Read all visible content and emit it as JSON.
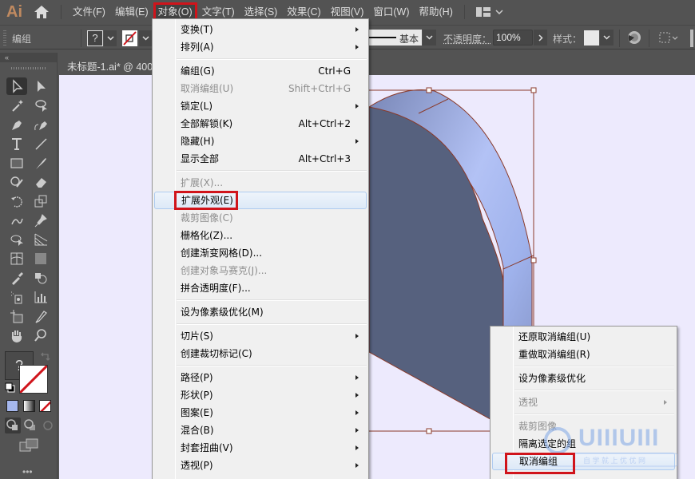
{
  "app": {
    "logo": "Ai"
  },
  "menubar": {
    "items": [
      {
        "label": "文件(F)"
      },
      {
        "label": "编辑(E)"
      },
      {
        "label": "对象(O)",
        "active": true
      },
      {
        "label": "文字(T)"
      },
      {
        "label": "选择(S)"
      },
      {
        "label": "效果(C)"
      },
      {
        "label": "视图(V)"
      },
      {
        "label": "窗口(W)"
      },
      {
        "label": "帮助(H)"
      }
    ]
  },
  "control_bar": {
    "selection_label": "编组",
    "fill_value": "?",
    "stroke_style": "基本",
    "opacity_label": "不透明度：",
    "opacity_value": "100%",
    "style_label": "样式："
  },
  "document": {
    "tab_title": "未标题-1.ai* @ 400"
  },
  "colors": {
    "accent_red": "#d0141b",
    "canvas_bg": "#edeafd",
    "shape_face": "#56617e",
    "shape_side": "#a5b4ee",
    "selection": "#8a3a2a"
  },
  "object_menu": {
    "items": [
      {
        "label": "变换(T)",
        "submenu": true
      },
      {
        "label": "排列(A)",
        "submenu": true
      },
      {
        "sep": true
      },
      {
        "label": "编组(G)",
        "shortcut": "Ctrl+G"
      },
      {
        "label": "取消编组(U)",
        "shortcut": "Shift+Ctrl+G",
        "disabled": true
      },
      {
        "label": "锁定(L)",
        "submenu": true
      },
      {
        "label": "全部解锁(K)",
        "shortcut": "Alt+Ctrl+2"
      },
      {
        "label": "隐藏(H)",
        "submenu": true
      },
      {
        "label": "显示全部",
        "shortcut": "Alt+Ctrl+3"
      },
      {
        "sep": true
      },
      {
        "label": "扩展(X)...",
        "disabled": true
      },
      {
        "label": "扩展外观(E)",
        "highlighted": true
      },
      {
        "label": "裁剪图像(C)",
        "disabled": true
      },
      {
        "label": "栅格化(Z)..."
      },
      {
        "label": "创建渐变网格(D)..."
      },
      {
        "label": "创建对象马赛克(J)...",
        "disabled": true
      },
      {
        "label": "拼合透明度(F)..."
      },
      {
        "sep": true
      },
      {
        "label": "设为像素级优化(M)"
      },
      {
        "sep": true
      },
      {
        "label": "切片(S)",
        "submenu": true
      },
      {
        "label": "创建裁切标记(C)"
      },
      {
        "sep": true
      },
      {
        "label": "路径(P)",
        "submenu": true
      },
      {
        "label": "形状(P)",
        "submenu": true
      },
      {
        "label": "图案(E)",
        "submenu": true
      },
      {
        "label": "混合(B)",
        "submenu": true
      },
      {
        "label": "封套扭曲(V)",
        "submenu": true
      },
      {
        "label": "透视(P)",
        "submenu": true
      }
    ]
  },
  "context_menu": {
    "items": [
      {
        "label": "还原取消编组(U)"
      },
      {
        "label": "重做取消编组(R)"
      },
      {
        "sep": true
      },
      {
        "label": "设为像素级优化"
      },
      {
        "sep": true
      },
      {
        "label": "透视",
        "submenu": true,
        "disabled": true
      },
      {
        "sep": true
      },
      {
        "label": "裁剪图像",
        "disabled": true
      },
      {
        "label": "隔离选定的组"
      },
      {
        "label": "取消编组",
        "highlighted": true
      }
    ]
  },
  "watermark": {
    "brand": "UIIIUIII",
    "tagline": "自 学 就 上 优 优 网"
  },
  "tools": [
    "selection-tool",
    "direct-selection-tool",
    "magic-wand-tool",
    "lasso-tool",
    "pen-tool",
    "curvature-tool",
    "type-tool",
    "line-tool",
    "rectangle-tool",
    "paintbrush-tool",
    "shaper-tool",
    "eraser-tool",
    "rotate-tool",
    "scale-tool",
    "puppet-warp-tool",
    "pin-tool",
    "shape-builder-tool",
    "perspective-grid-tool",
    "mesh-tool",
    "gradient-tool",
    "eyedropper-tool",
    "blend-tool",
    "symbol-sprayer-tool",
    "column-graph-tool",
    "artboard-tool",
    "slice-tool",
    "hand-tool",
    "zoom-tool"
  ]
}
